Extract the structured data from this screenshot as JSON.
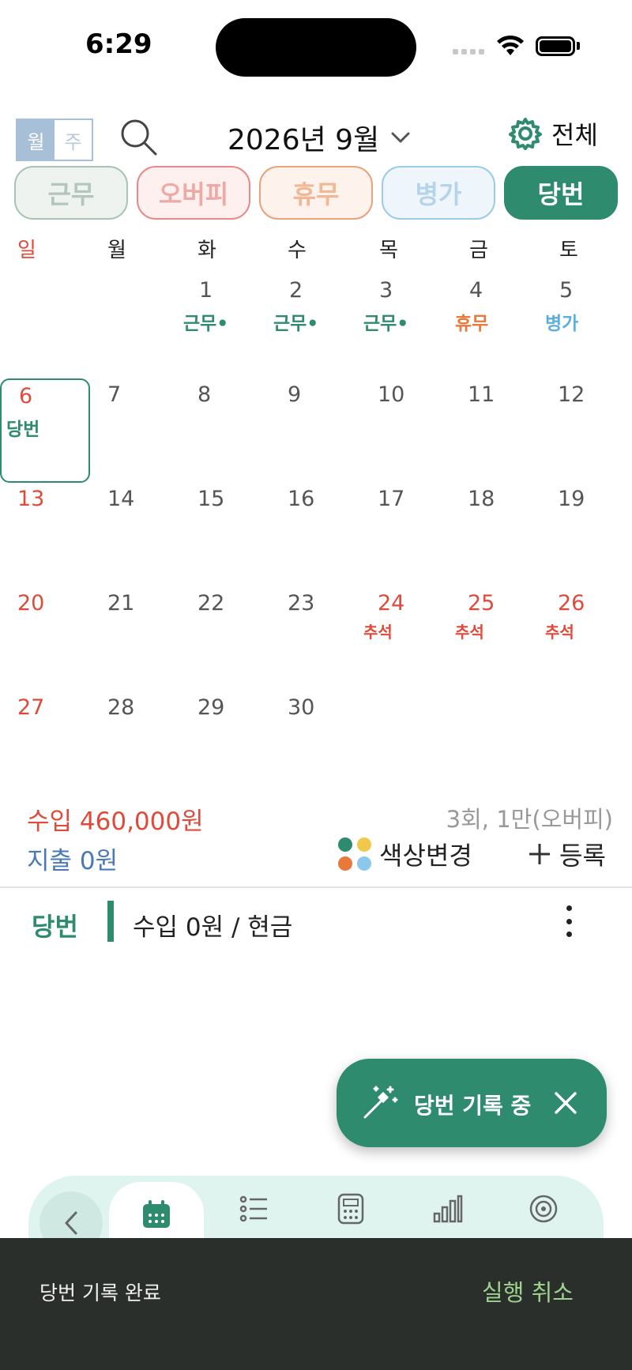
{
  "status_bar": {
    "time": "6:29"
  },
  "header": {
    "view_month": "월",
    "view_week": "주",
    "month_title": "2026년 9월",
    "settings_label": "전체"
  },
  "shift_chips": [
    "근무",
    "오버피",
    "휴무",
    "병가",
    "당번"
  ],
  "weekdays": [
    "일",
    "월",
    "화",
    "수",
    "목",
    "금",
    "토"
  ],
  "calendar": {
    "days": [
      "1",
      "2",
      "3",
      "4",
      "5",
      "6",
      "7",
      "8",
      "9",
      "10",
      "11",
      "12",
      "13",
      "14",
      "15",
      "16",
      "17",
      "18",
      "19",
      "20",
      "21",
      "22",
      "23",
      "24",
      "25",
      "26",
      "27",
      "28",
      "29",
      "30"
    ],
    "shifts": {
      "d1": "근무•",
      "d2": "근무•",
      "d3": "근무•",
      "d4": "휴무",
      "d5": "병가",
      "d6": "당번",
      "d24": "추석",
      "d25": "추석",
      "d26": "추석"
    }
  },
  "summary": {
    "income": "수입 460,000원",
    "count": "3회, 1만(오버피)",
    "expense": "지출 0원",
    "color_change": "색상변경",
    "register": "등록"
  },
  "record": {
    "tag": "당번",
    "text": "수입 0원 / 현금"
  },
  "fab": {
    "label": "당번 기록 중"
  },
  "snackbar": {
    "message": "당번 기록 완료",
    "undo": "실행 취소"
  },
  "colors": {
    "accent": "#2e8b6e",
    "red": "#e04a3a",
    "orange": "#e8793a",
    "blue": "#5aaee0",
    "dot_green": "#2e8b6e",
    "dot_yellow": "#f2c84b",
    "dot_orange": "#e8793a",
    "dot_blue": "#8cc8ec"
  },
  "icons": {
    "search": "search-icon",
    "chevron": "chevron-down-icon",
    "settings": "gear-icon",
    "plus": "plus-icon",
    "more": "more-vertical-icon",
    "wand": "magic-wand-icon",
    "close": "close-icon",
    "back": "chevron-left-icon",
    "calendar": "calendar-icon",
    "list": "list-icon",
    "calculator": "calculator-icon",
    "chart": "bar-chart-icon",
    "target": "target-icon"
  }
}
